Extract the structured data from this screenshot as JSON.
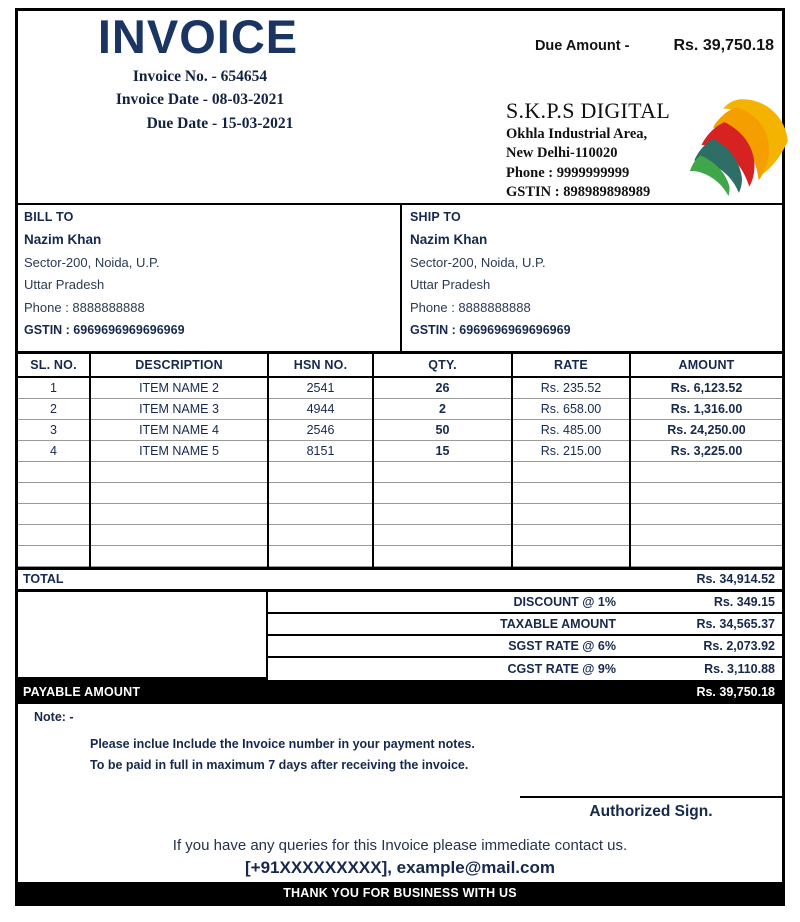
{
  "header": {
    "title": "INVOICE",
    "invoice_no_line": "Invoice No. -  654654",
    "invoice_date_line": "Invoice Date -  08-03-2021",
    "due_date_line": "Due Date -  15-03-2021",
    "due_amount_label": "Due Amount -",
    "due_amount_value": "Rs. 39,750.18"
  },
  "company": {
    "name": "S.K.P.S DIGITAL",
    "address_line1": "Okhla Industrial Area,",
    "address_line2": "New Delhi-110020",
    "phone": "Phone : 9999999999",
    "gstin": "GSTIN : 898989898989",
    "logo_icon": "color-swoosh-logo"
  },
  "bill_to": {
    "heading": "BILL TO",
    "name": "Nazim Khan",
    "address": "Sector-200, Noida, U.P.",
    "state": "Uttar Pradesh",
    "phone": "Phone : 8888888888",
    "gstin": "GSTIN : 6969696969696969"
  },
  "ship_to": {
    "heading": "SHIP TO",
    "name": "Nazim Khan",
    "address": "Sector-200, Noida, U.P.",
    "state": "Uttar Pradesh",
    "phone": "Phone : 8888888888",
    "gstin": "GSTIN : 6969696969696969"
  },
  "items_table": {
    "columns": [
      "SL. NO.",
      "DESCRIPTION",
      "HSN NO.",
      "QTY.",
      "RATE",
      "AMOUNT"
    ],
    "rows": [
      {
        "sl": "1",
        "description": "ITEM NAME 2",
        "hsn": "2541",
        "qty": "26",
        "rate": "Rs. 235.52",
        "amount": "Rs. 6,123.52"
      },
      {
        "sl": "2",
        "description": "ITEM NAME 3",
        "hsn": "4944",
        "qty": "2",
        "rate": "Rs. 658.00",
        "amount": "Rs. 1,316.00"
      },
      {
        "sl": "3",
        "description": "ITEM NAME 4",
        "hsn": "2546",
        "qty": "50",
        "rate": "Rs. 485.00",
        "amount": "Rs. 24,250.00"
      },
      {
        "sl": "4",
        "description": "ITEM NAME 5",
        "hsn": "8151",
        "qty": "15",
        "rate": "Rs. 215.00",
        "amount": "Rs. 3,225.00"
      }
    ],
    "empty_row_count": 5
  },
  "totals": {
    "total_label": "TOTAL",
    "total_value": "Rs. 34,914.52",
    "lines": [
      {
        "label": "DISCOUNT @ 1%",
        "value": "Rs. 349.15"
      },
      {
        "label": "TAXABLE AMOUNT",
        "value": "Rs. 34,565.37"
      },
      {
        "label": "SGST RATE @  6%",
        "value": "Rs. 2,073.92"
      },
      {
        "label": "CGST RATE @ 9%",
        "value": "Rs. 3,110.88"
      }
    ],
    "payable_label": "PAYABLE AMOUNT",
    "payable_value": "Rs. 39,750.18"
  },
  "notes": {
    "heading": "Note: -",
    "line1": "Please inclue Include the Invoice number in your payment notes.",
    "line2": "To be paid in full in maximum 7 days after receiving the invoice."
  },
  "signature": {
    "label": "Authorized Sign."
  },
  "footer": {
    "queries_line": "If you have any queries for this Invoice  please immediate contact us.",
    "contact_line": "[+91XXXXXXXXX], example@mail.com",
    "thanks_line": "THANK YOU FOR BUSINESS WITH US"
  },
  "colors": {
    "navy": "#16294d",
    "title_navy": "#1b3563",
    "black_bar": "#000000"
  }
}
